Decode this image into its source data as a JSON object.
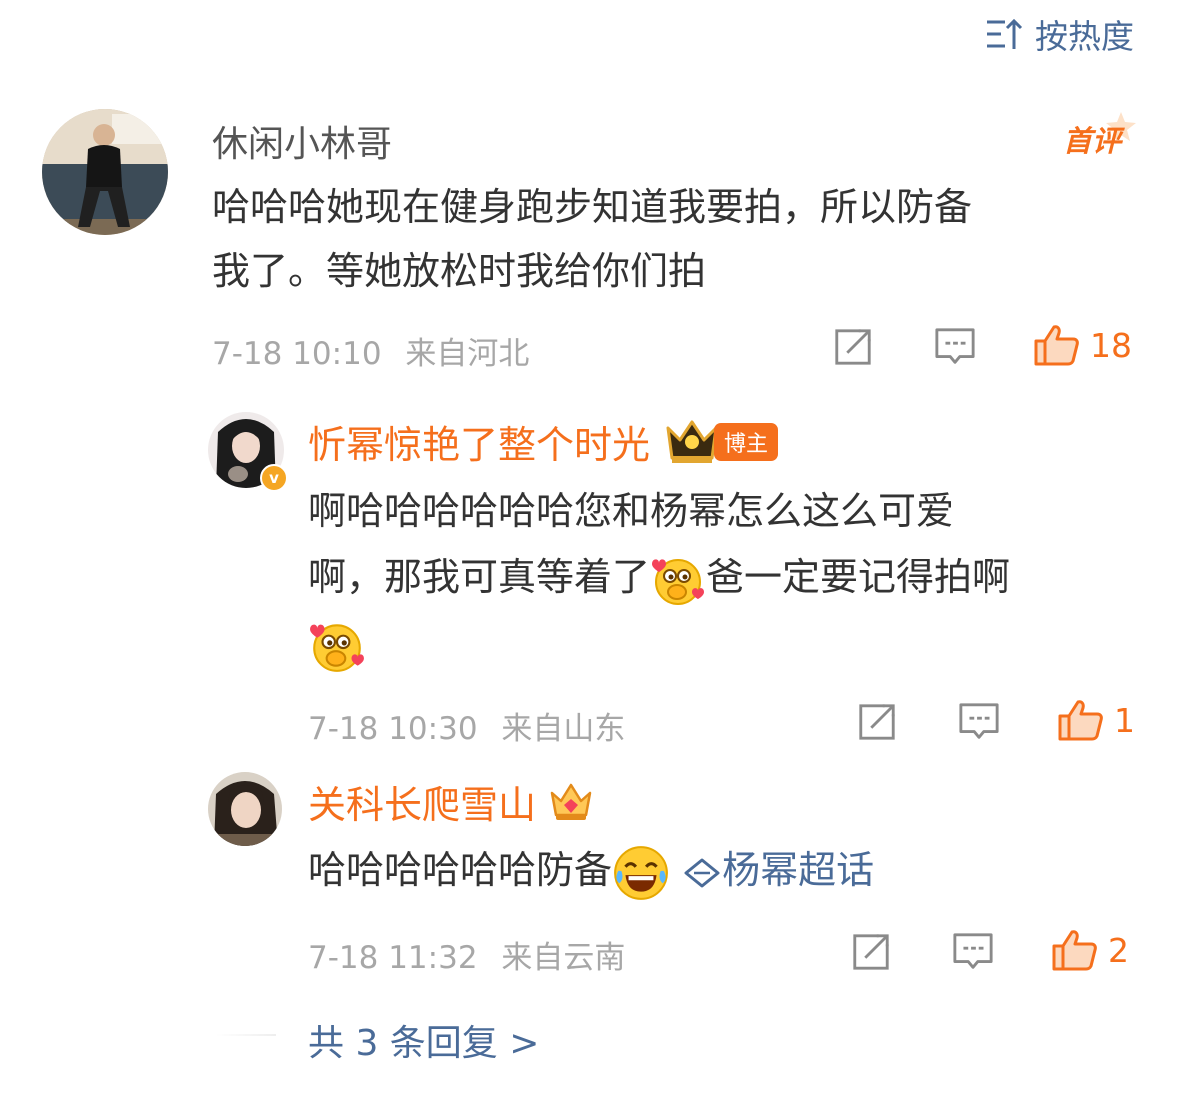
{
  "sort": {
    "icon": "sort-icon",
    "label": "按热度"
  },
  "comment": {
    "username": "休闲小林哥",
    "badge": "首评",
    "text_line1": "哈哈哈她现在健身跑步知道我要拍，所以防备",
    "text_line2": "我了。等她放松时我给你们拍",
    "time": "7-18 10:10",
    "location": "来自河北",
    "likes": "18"
  },
  "replies": [
    {
      "username": "忻幂惊艳了整个时光",
      "role_badge": "博主",
      "text_line1": "啊哈哈哈哈哈哈您和杨幂怎么这么可爱",
      "text_line2a": "啊，那我可真等着了",
      "text_line2b": "爸一定要记得拍啊",
      "time": "7-18 10:30",
      "location": "来自山东",
      "likes": "1"
    },
    {
      "username": "关科长爬雪山",
      "text_a": "哈哈哈哈哈哈防备",
      "topic": "杨幂超话",
      "time": "7-18 11:32",
      "location": "来自云南",
      "likes": "2"
    }
  ],
  "more_replies": "共 3 条回复 >",
  "colors": {
    "accent": "#f56f1c",
    "link": "#4a6b98",
    "meta": "#a7a7a7"
  }
}
